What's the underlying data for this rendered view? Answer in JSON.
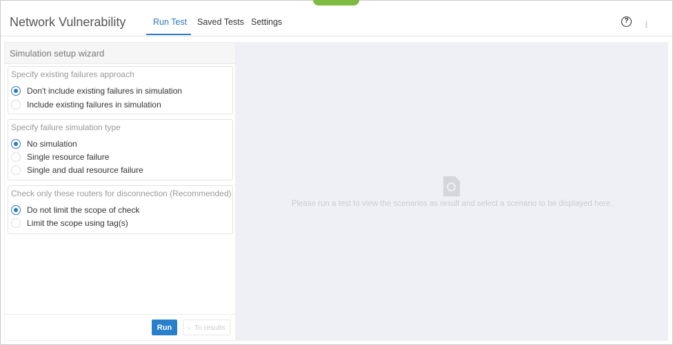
{
  "header": {
    "title": "Network Vulnerability",
    "tabs": [
      "Run Test",
      "Saved Tests",
      "Settings"
    ],
    "active_tab": "Run Test",
    "help": "?"
  },
  "wizard": {
    "title": "Simulation setup wizard",
    "sections": [
      {
        "heading": "Specify existing failures approach",
        "options": [
          "Don't include existing failures in simulation",
          "Include existing failures in simulation"
        ],
        "selected": 0
      },
      {
        "heading": "Specify failure simulation type",
        "options": [
          "No simulation",
          "Single resource failure",
          "Single and dual resource failure"
        ],
        "selected": 0
      },
      {
        "heading": "Check only these routers for disconnection (Recommended)",
        "options": [
          "Do not limit the scope of check",
          "Limit the scope using tag(s)"
        ],
        "selected": 0
      }
    ],
    "run": "Run",
    "to_results": "To results"
  },
  "results": {
    "empty_message": "Please run a test to view the scenarios as result and select a scenario to be displayed here."
  }
}
